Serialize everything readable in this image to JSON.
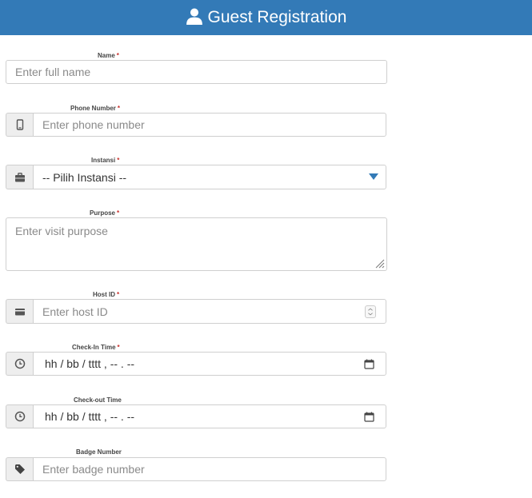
{
  "header": {
    "title": "Guest Registration",
    "icon": "user-icon"
  },
  "form": {
    "name": {
      "label": "Name",
      "required": "*",
      "placeholder": "Enter full name"
    },
    "phone": {
      "label": "Phone Number",
      "required": "*",
      "placeholder": "Enter phone number",
      "icon": "mobile-icon"
    },
    "instansi": {
      "label": "Instansi",
      "required": "*",
      "selected": "-- Pilih Instansi --",
      "icon": "briefcase-icon"
    },
    "purpose": {
      "label": "Purpose",
      "required": "*",
      "placeholder": "Enter visit purpose"
    },
    "host_id": {
      "label": "Host ID",
      "required": "*",
      "placeholder": "Enter host ID",
      "icon": "id-card-icon"
    },
    "check_in": {
      "label": "Check-In Time",
      "required": "*",
      "value": "hh / bb / tttt ,  -- . --",
      "icon": "clock-icon"
    },
    "check_out": {
      "label": "Check-out Time",
      "value": "hh / bb / tttt ,  -- . --",
      "icon": "clock-icon"
    },
    "badge": {
      "label": "Badge Number",
      "placeholder": "Enter badge number",
      "icon": "tag-icon"
    }
  },
  "colors": {
    "header_bg": "#337ab7",
    "required": "#c9302c",
    "addon_bg": "#eeeeee"
  }
}
